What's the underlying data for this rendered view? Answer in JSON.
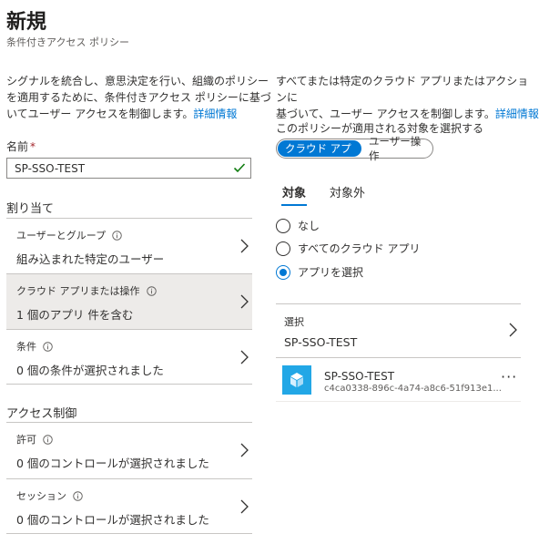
{
  "header": {
    "title": "新規",
    "subtitle": "条件付きアクセス ポリシー"
  },
  "left": {
    "desc_lines": [
      "シグナルを統合し、意思決定を行い、組織のポリシー",
      "を適用するために、条件付きアクセス ポリシーに基づ",
      "いてユーザー アクセスを制御します。"
    ],
    "desc_link": "詳細情報",
    "name_label": "名前",
    "required_mark": "*",
    "name_value": "SP-SSO-TEST",
    "assign_heading": "割り当て",
    "assign_rows": [
      {
        "label": "ユーザーとグループ",
        "value": "組み込まれた特定のユーザー"
      },
      {
        "label": "クラウド アプリまたは操作",
        "value": "1 個のアプリ 件を含む"
      },
      {
        "label": "条件",
        "value": "0 個の条件が選択されました"
      }
    ],
    "access_heading": "アクセス制御",
    "access_rows": [
      {
        "label": "許可",
        "value": "0 個のコントロールが選択されました"
      },
      {
        "label": "セッション",
        "value": "0 個のコントロールが選択されました"
      }
    ]
  },
  "right": {
    "desc_lines": [
      "すべてまたは特定のクラウド アプリまたはアクションに",
      "基づいて、ユーザー アクセスを制御します。"
    ],
    "desc_link": "詳細情報",
    "assign_label": "このポリシーが適用される対象を選択する",
    "pill_on": "クラウド アプリ",
    "pill_off": "ユーザー操作",
    "tabs": [
      "対象",
      "対象外"
    ],
    "radios": [
      "なし",
      "すべてのクラウド アプリ",
      "アプリを選択"
    ],
    "select_label": "選択",
    "select_value": "SP-SSO-TEST",
    "app": {
      "name": "SP-SSO-TEST",
      "id": "c4ca0338-896c-4a74-a8c6-51f913e1...",
      "more": "···"
    }
  },
  "colors": {
    "accent": "#0078d4",
    "valid_check": "#107c10",
    "app_tile": "#22a7e6"
  }
}
